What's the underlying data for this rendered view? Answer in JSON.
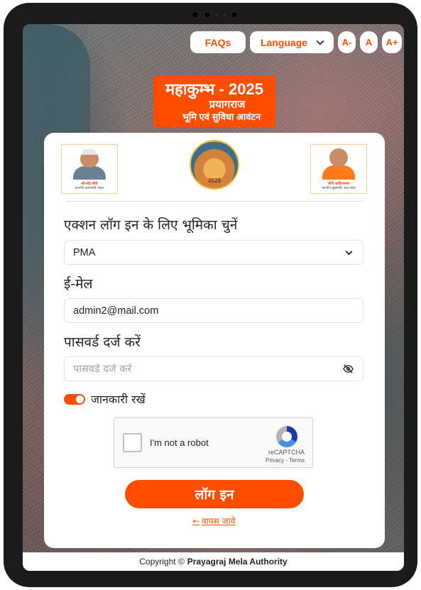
{
  "header": {
    "faqs_label": "FAQs",
    "language_label": "Language",
    "font_decrease": "A-",
    "font_normal": "A",
    "font_increase": "A+"
  },
  "banner": {
    "title": "महाकुम्भ - 2025",
    "subtitle": "प्रयागराज",
    "tagline": "भूमि एवं सुविधा आवंटन"
  },
  "portraits": {
    "left_name": "श्री नरेंद्र मोदी",
    "left_title": "माननीय प्रधानमंत्री, भारत",
    "right_name": "योगी आदित्यनाथ",
    "right_title": "माननीय मुख्यमंत्री, उत्तर प्रदेश"
  },
  "emblem": {
    "year": "2025"
  },
  "form": {
    "role_label": "एक्शन लॉग इन के लिए भूमिका चुनें",
    "role_value": "PMA",
    "email_label": "ई-मेल",
    "email_value": "admin2@mail.com",
    "password_label": "पासवर्ड दर्ज करें",
    "password_placeholder": "पासवर्ड दर्ज करें",
    "remember_label": "जानकारी रखें",
    "remember_on": true,
    "login_label": "लॉग इन",
    "back_label": "वापस जाये"
  },
  "captcha": {
    "label": "I'm not a robot",
    "brand": "reCAPTCHA",
    "links": "Privacy - Terms"
  },
  "footer": {
    "prefix": "Copyright ©",
    "org": "Prayagraj Mela Authority"
  },
  "colors": {
    "accent": "#ff4d00",
    "device": "#1b1b1b"
  }
}
